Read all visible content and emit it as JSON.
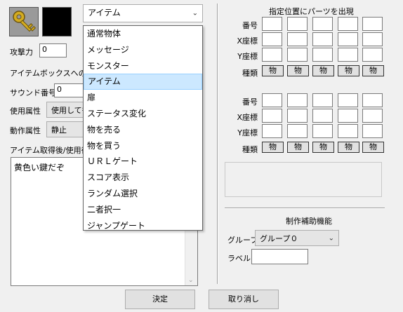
{
  "left": {
    "item_type_combo": "アイテム",
    "attack_label": "攻撃力",
    "attack_value": "0",
    "itembox_label": "アイテムボックスへの格",
    "sound_label": "サウンド番号",
    "sound_value": "0",
    "use_label": "使用属性",
    "use_value": "使用しても",
    "action_label": "動作属性",
    "action_value": "静止",
    "message_label": "アイテム取得後/使用後",
    "message_text": "黄色い鍵だぞ"
  },
  "dropdown": {
    "selected_index": 3,
    "items": [
      "通常物体",
      "メッセージ",
      "モンスター",
      "アイテム",
      "扉",
      "ステータス変化",
      "物を売る",
      "物を買う",
      "ＵＲＬゲート",
      "スコア表示",
      "ランダム選択",
      "二者択一",
      "ジャンプゲート"
    ]
  },
  "right": {
    "title": "指定位置にパーツを出現",
    "row_number": "番号",
    "row_x": "X座標",
    "row_y": "Y座標",
    "row_kind": "種類",
    "kind_button": "物",
    "assist_title": "制作補助機能",
    "group_label": "グループ",
    "group_value": "グループ０",
    "label_label": "ラベル",
    "label_value": ""
  },
  "footer": {
    "ok": "決定",
    "cancel": "取り消し"
  },
  "colors": {
    "selection_bg": "#cce8ff",
    "key_icon": "#c8a020"
  }
}
